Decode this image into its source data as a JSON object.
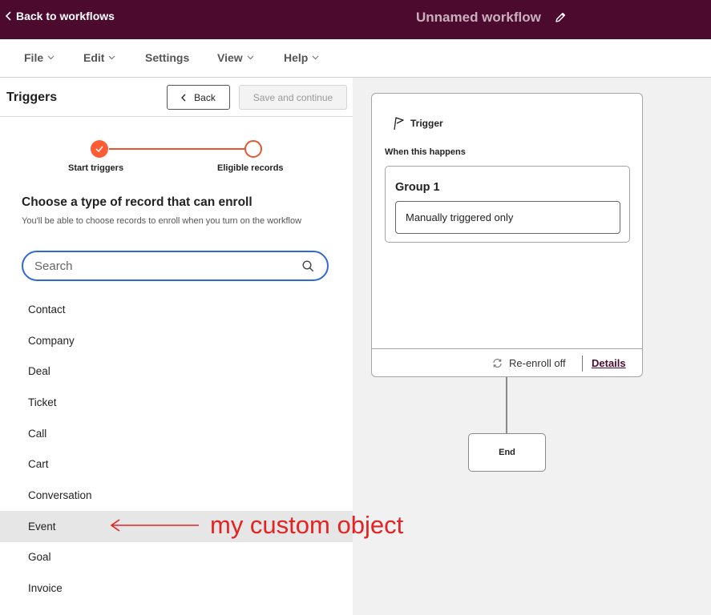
{
  "topbar": {
    "back_label": "Back to workflows",
    "workflow_title": "Unnamed workflow"
  },
  "menu": [
    "File",
    "Edit",
    "Settings",
    "View",
    "Help"
  ],
  "panel": {
    "title": "Triggers",
    "back_button": "Back",
    "save_button": "Save and continue",
    "steps": [
      "Start triggers",
      "Eligible records"
    ],
    "section_title": "Choose a type of record that can enroll",
    "section_desc": "You'll be able to choose records to enroll when you turn on the workflow",
    "search_placeholder": "Search",
    "records": [
      "Contact",
      "Company",
      "Deal",
      "Ticket",
      "Call",
      "Cart",
      "Conversation",
      "Event",
      "Goal",
      "Invoice"
    ]
  },
  "annotation": {
    "text": "my custom object",
    "color": "#e52222"
  },
  "canvas": {
    "trigger_label": "Trigger",
    "when_label": "When this happens",
    "group_title": "Group 1",
    "criteria": "Manually triggered only",
    "reenroll": "Re-enroll off",
    "details": "Details",
    "end_label": "End"
  },
  "colors": {
    "topbar_bg": "#4c0a2e",
    "accent_orange": "#ff5c35",
    "focus_blue": "#2d6bd0"
  }
}
